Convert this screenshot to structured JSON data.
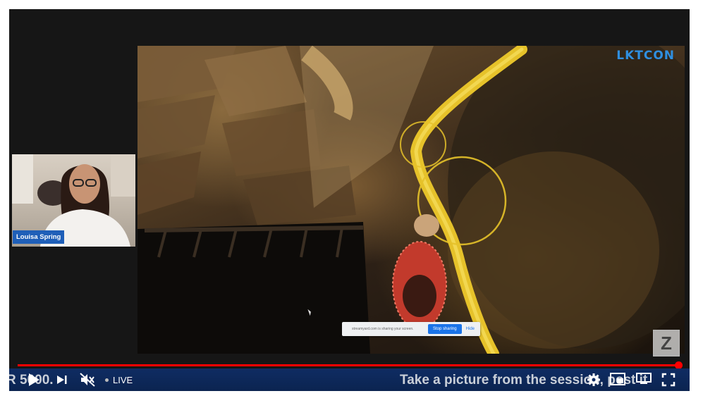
{
  "video": {
    "presenter_name": "Louisa Spring",
    "logo_text": "LKTCON",
    "watermark_text": "Z",
    "share_bar": {
      "message": "streamyard.com is sharing your screen.",
      "stop_label": "Stop sharing",
      "hide_label": "Hide"
    }
  },
  "ticker": {
    "left_text": "R 5000.",
    "right_text": "Take a picture from the session, post it"
  },
  "controls": {
    "live_label": "LIVE",
    "progress_fraction": 0.997,
    "icons": [
      "play-icon",
      "next-icon",
      "mute-icon",
      "settings-icon",
      "miniplayer-icon",
      "theater-icon",
      "fullscreen-icon"
    ]
  },
  "colors": {
    "progress": "#ff0000",
    "control_bar": "#0f2c63",
    "name_tag": "#1f5fb8",
    "pipe": "#e6c22a"
  }
}
